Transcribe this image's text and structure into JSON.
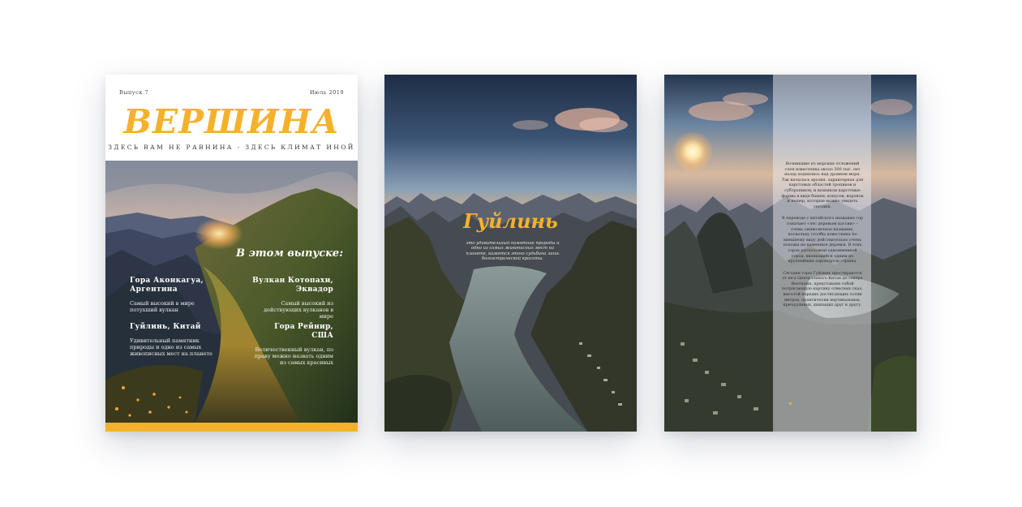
{
  "cover": {
    "issue": "Выпуск 7",
    "date": "Июль 2019",
    "title": "ВЕРШИНА",
    "tagline": "ЗДЕСЬ ВАМ НЕ РАВНИНА - ЗДЕСЬ КЛИМАТ ИНОЙ",
    "in_issue": "В этом выпуске:",
    "items": [
      {
        "title": "Гора Аконкагуа, Аргентина",
        "desc": "Самый высокий в мире потухший вулкан"
      },
      {
        "title": "Вулкан Котопахи, Эквадор",
        "desc": "Самый высокий из действующих вулканов в мире"
      },
      {
        "title": "Гуйлинь, Китай",
        "desc": "Удивительный памятник природы и одно из самых живописных мест на планете"
      },
      {
        "title": "Гора Рейнир, США",
        "desc": "Величественный вулкан, по праву можно назвать одним из самых красивых"
      }
    ]
  },
  "spread": {
    "title": "Гуйлинь",
    "text": "это удивительный памятник природы и одно из самых живописных мест на планете, кажется этого судьбина лишь богоэстрической красоты."
  },
  "article": {
    "paragraphs": [
      "Возникшие из морских отложений слоя известняка около 300 тыс. лет назад поднялись над уровнем моря. Так началась эрозия, характерная для карстовых областей тропиков и субтропиков, и возникли карстовые формы в виде башен, конусов, воронок и пещер, которые можно увидеть сегодня.",
      "В переводе с китайского название гор означает «лес деревьев кассии» – очень символичное название, поскольку столбы известняка по внешнему виду действительно очень похожи на каменные деревья. В этих горах расположен одноименный город, являющийся одним из крупнейших аэропортов страны.",
      "Сегодня горы Гуйлинь простираются от юга Центрального Китая до севера Вьетнама, представляя собой потрясающую картину отвесных скал, высотой нередко достигающих сотни метров, практически вертикальных, причудливых, кишащих друг к другу."
    ]
  },
  "colors": {
    "accent": "#f6b12c"
  }
}
